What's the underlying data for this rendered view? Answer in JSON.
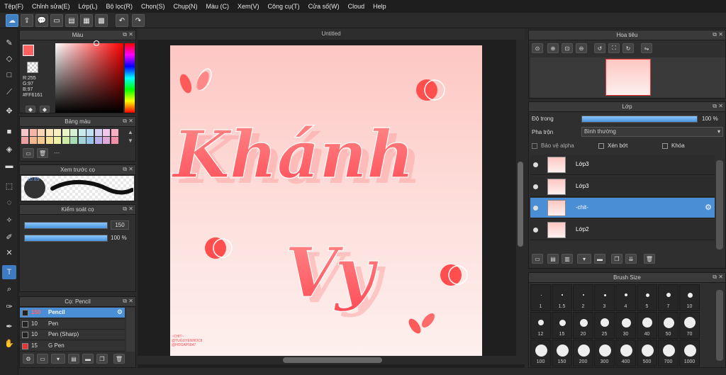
{
  "menu": [
    "Tệp(F)",
    "Chỉnh sửa(E)",
    "Lớp(L)",
    "Bộ lọc(R)",
    "Chọn(S)",
    "Chụp(N)",
    "Màu (C)",
    "Xem(V)",
    "Công cụ(T)",
    "Cửa số(W)",
    "Cloud",
    "Help"
  ],
  "canvas": {
    "title": "Untitled",
    "art_text_1": "Khánh",
    "art_text_2": "Vy",
    "credit": "~CHIT~ @TUGUYENHOC8 @HOGAP5847"
  },
  "color_panel": {
    "title": "Màu",
    "r": "R:255",
    "g": "G:97",
    "b": "B:97",
    "hex": "#FF6161",
    "current_color": "#ff6161"
  },
  "swatch_panel": {
    "title": "Bảng màu",
    "dash": "---",
    "swatches": [
      "#f6c6c6",
      "#f4b6a8",
      "#f9d5b5",
      "#fbe6b8",
      "#f9f1c2",
      "#e9f5c8",
      "#d7f0d4",
      "#c8ecec",
      "#c3dff2",
      "#d5d0f2",
      "#f0c8ea",
      "#f9b0c4",
      "#e8a0a0",
      "#f2b890",
      "#f4c88e",
      "#f6e39a",
      "#f0f0a8",
      "#cfe9a8",
      "#a8dcb4",
      "#a0d4d8",
      "#98c4e8",
      "#b8b0e8",
      "#e0a8d8",
      "#f090a8"
    ]
  },
  "brush_preview": {
    "title": "Xem trước cọ",
    "size_value": "10.85"
  },
  "brush_control": {
    "title": "Kiểm soát cọ",
    "size": "150",
    "opacity": "100 %"
  },
  "brush_list": {
    "title": "Cọ: Pencil",
    "items": [
      {
        "size": "150",
        "name": "Pencil",
        "active": true
      },
      {
        "size": "10",
        "name": "Pen"
      },
      {
        "size": "10",
        "name": "Pen (Sharp)"
      },
      {
        "size": "15",
        "name": "G Pen"
      }
    ]
  },
  "navigator": {
    "title": "Hoa tiêu"
  },
  "layer_panel": {
    "title": "Lớp",
    "opacity_label": "Độ trong",
    "opacity_value": "100 %",
    "blend_label": "Pha trộn",
    "blend_value": "Bình thường",
    "protect_alpha": "Bảo vệ alpha",
    "clipping": "Xén bớt",
    "lock": "Khóa",
    "layers": [
      {
        "name": "Lớp3"
      },
      {
        "name": "Lớp3"
      },
      {
        "name": "-chit-",
        "active": true
      },
      {
        "name": "Lớp2"
      }
    ]
  },
  "brush_size_panel": {
    "title": "Brush Size",
    "sizes": [
      "1",
      "1.5",
      "2",
      "3",
      "4",
      "5",
      "7",
      "10",
      "12",
      "15",
      "20",
      "25",
      "30",
      "40",
      "50",
      "70",
      "100",
      "150",
      "200",
      "300",
      "400",
      "500",
      "700",
      "1000"
    ]
  }
}
